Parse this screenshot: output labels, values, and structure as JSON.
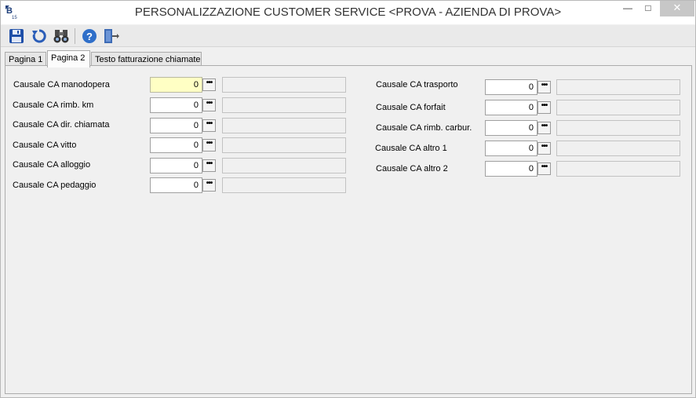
{
  "window": {
    "title": "PERSONALIZZAZIONE CUSTOMER SERVICE <PROVA - AZIENDA DI PROVA>",
    "app_icon_text": "B",
    "app_icon_sub": "15",
    "minimize_glyph": "—",
    "maximize_glyph": "□",
    "close_glyph": "✕"
  },
  "toolbar": {
    "buttons": [
      {
        "name": "save-icon"
      },
      {
        "name": "refresh-icon"
      },
      {
        "name": "search-binoculars-icon"
      },
      {
        "name": "help-icon"
      },
      {
        "name": "exit-door-icon"
      }
    ]
  },
  "tabs": [
    {
      "label": "Pagina 1",
      "active": false
    },
    {
      "label": "Pagina 2",
      "active": true
    },
    {
      "label": "Testo fatturazione chiamate",
      "active": false
    }
  ],
  "lookup_glyph": "•••",
  "left_fields": [
    {
      "label": "Causale CA manodopera",
      "value": "0",
      "highlighted": true
    },
    {
      "label": "Causale CA rimb. km",
      "value": "0"
    },
    {
      "label": "Causale CA dir. chiamata",
      "value": "0"
    },
    {
      "label": "Causale CA vitto",
      "value": "0"
    },
    {
      "label": "Causale CA alloggio",
      "value": "0"
    },
    {
      "label": "Causale CA pedaggio",
      "value": "0"
    }
  ],
  "right_fields": [
    {
      "label": "Causale CA trasporto",
      "value": "0"
    },
    {
      "label": "Causale CA forfait",
      "value": "0"
    },
    {
      "label": "Causale CA rimb. carbur.",
      "value": "0"
    },
    {
      "label": "Causale CA  altro 1",
      "value": "0"
    },
    {
      "label": "Causale CA altro 2",
      "value": "0"
    }
  ],
  "colors": {
    "focused_field": "#ffffc4",
    "help_blue": "#2f6fc9",
    "save_blue": "#1f4fa8"
  }
}
